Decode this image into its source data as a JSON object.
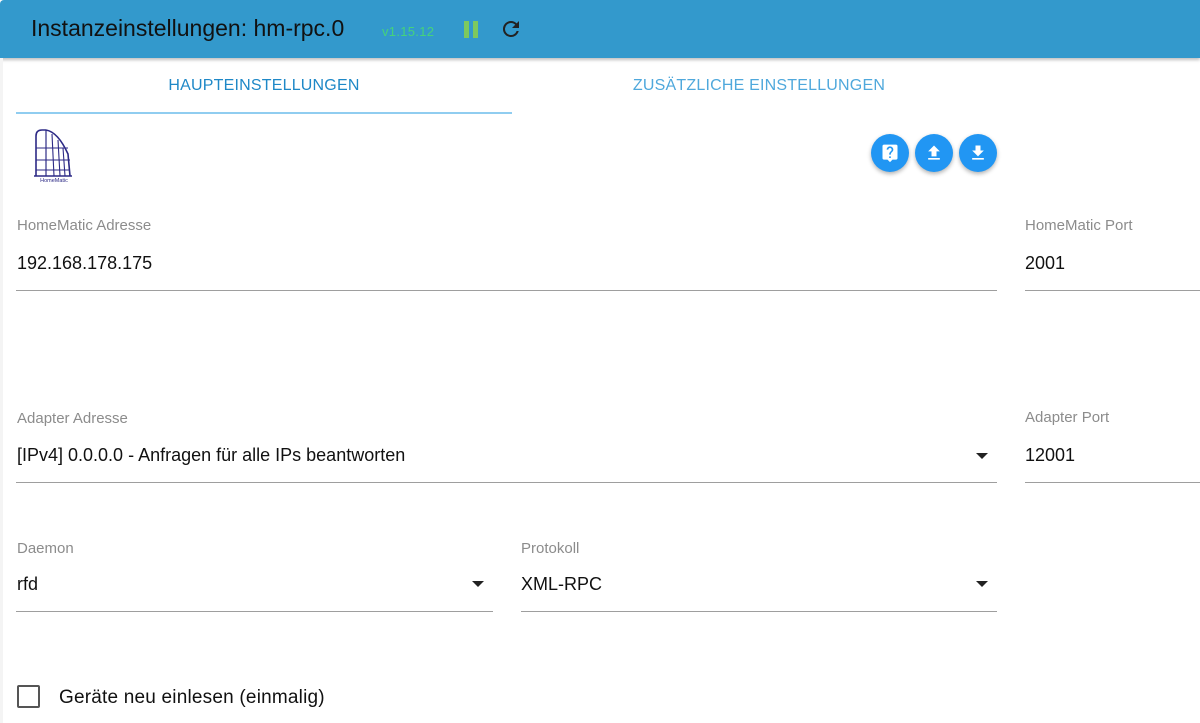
{
  "header": {
    "title": "Instanzeinstellungen: hm-rpc.0",
    "version": "v1.15.12",
    "pause_icon": "pause-icon",
    "reload_icon": "reload-icon",
    "bar_color": "#3399cc"
  },
  "tabs": [
    {
      "label": "HAUPTEINSTELLUNGEN",
      "active": true
    },
    {
      "label": "ZUSÄTZLICHE EINSTELLUNGEN",
      "active": false
    }
  ],
  "logo": {
    "text": "HomeMatic",
    "icon": "homematic-logo"
  },
  "actions": {
    "help_icon": "help-icon",
    "upload_icon": "upload-icon",
    "download_icon": "download-icon",
    "accent_color": "#2196f3"
  },
  "fields": {
    "homematic_address": {
      "label": "HomeMatic Adresse",
      "value": "192.168.178.175"
    },
    "homematic_port": {
      "label": "HomeMatic Port",
      "value": "2001"
    },
    "adapter_address": {
      "label": "Adapter Adresse",
      "value": "[IPv4] 0.0.0.0 - Anfragen für alle IPs beantworten"
    },
    "adapter_port": {
      "label": "Adapter Port",
      "value": "12001"
    },
    "daemon": {
      "label": "Daemon",
      "value": "rfd"
    },
    "protocol": {
      "label": "Protokoll",
      "value": "XML-RPC"
    }
  },
  "checkbox": {
    "label": "Geräte neu einlesen (einmalig)",
    "checked": false
  }
}
